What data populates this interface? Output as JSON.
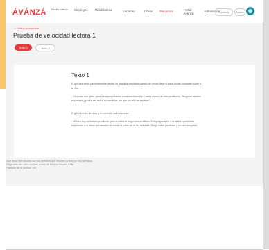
{
  "header": {
    "logo": "ÁVÁNZÁ",
    "logo_sub": "Sextio basico",
    "nav": [
      {
        "label": "Mi proyec"
      },
      {
        "label": "Mi biblioteca"
      },
      {
        "label": "Lecturas"
      },
      {
        "label": "Libros"
      },
      {
        "label": "Recursos"
      },
      {
        "label": "Club Avanzá"
      },
      {
        "label": "Administrar"
      }
    ],
    "contact": "Contacto",
    "help": "Ayuda"
  },
  "breadcrumb": "← Volver a recursos",
  "page_title": "Prueba de velocidad lectora 1",
  "tabs": [
    {
      "label": "Texto 1"
    },
    {
      "label": "Texto 2"
    }
  ],
  "card": {
    "title": "Texto 1",
    "paragraphs": [
      "El grillo se sentó pacientemente dentro de la araña crepitaba cuando de pronto llegó el sapo donde comparte sobre a la ribo.",
      "- Chucolas don grillo, para los sapos también comemos insectos y usted es uno de mis predilectos. Tengo un hambre espantosa ¿podría ser usted mi merienda, sin que por ello se espante?",
      "El grillo lo miró de reojo y le contestó malhumorado:",
      "- Mi tuca soy su insecto predilecto, pero a usted le tengo mucho afecto. Estoy esperando a la araña, quien está esperando a la abeja que termine de comer el polen de la flor después. Tengo usted paciencia y no sea arrogante."
    ]
  },
  "footer": [
    "Este texto reproducido con los derechos que resulten al final por sus servicios.",
    "Fragmento de: Libro cuentos cortos de Morena Kusant, Chile",
    "Palabras de la prueba: 126"
  ]
}
